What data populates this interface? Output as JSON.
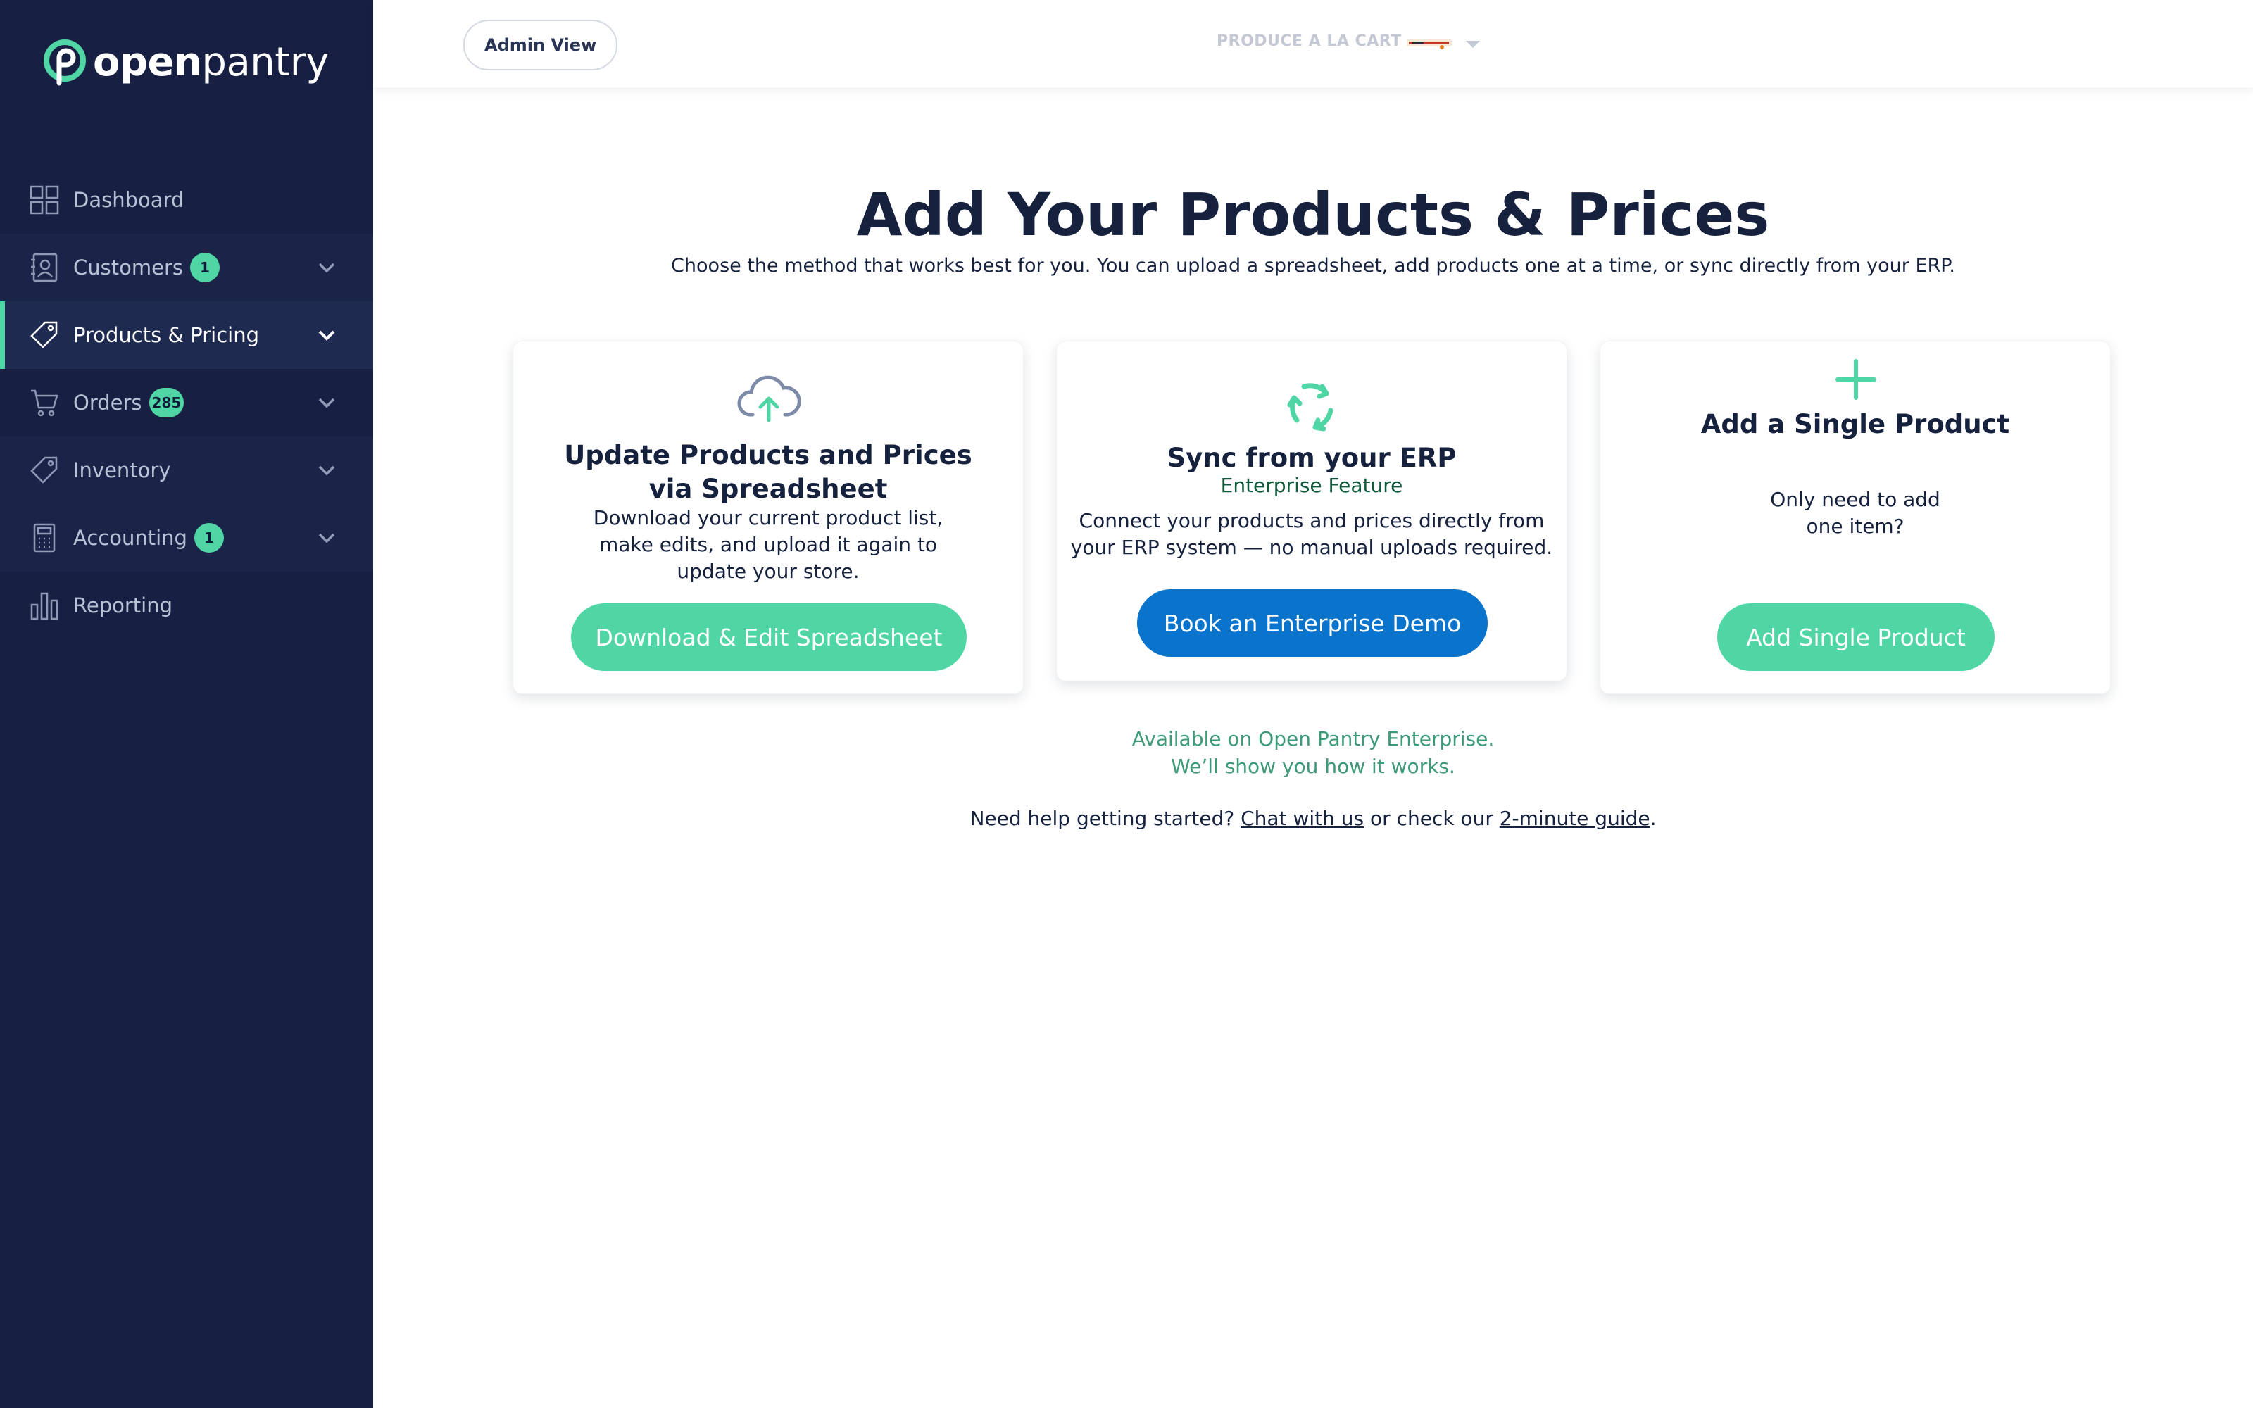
{
  "brand": {
    "name_bold": "open",
    "name_rest": "pantry",
    "accent": "#4fd6a4",
    "sidebar_bg": "#172042"
  },
  "sidebar": {
    "items": [
      {
        "label": "Dashboard",
        "icon": "grid-icon",
        "badge": null,
        "chevron": false
      },
      {
        "label": "Customers",
        "icon": "contacts-icon",
        "badge": "1",
        "chevron": true
      },
      {
        "label": "Products & Pricing",
        "icon": "tag-icon",
        "badge": null,
        "chevron": true,
        "active": true
      },
      {
        "label": "Orders",
        "icon": "cart-icon",
        "badge": "285",
        "chevron": true
      },
      {
        "label": "Inventory",
        "icon": "tag-icon",
        "badge": null,
        "chevron": true
      },
      {
        "label": "Accounting",
        "icon": "calculator-icon",
        "badge": "1",
        "chevron": true
      },
      {
        "label": "Reporting",
        "icon": "bar-chart-icon",
        "badge": null,
        "chevron": false
      }
    ]
  },
  "topbar": {
    "admin_view_label": "Admin View",
    "store_name": "PRODUCE A LA CART"
  },
  "main": {
    "title": "Add Your Products & Prices",
    "subtitle": "Choose the method that works best for you. You can upload a spreadsheet, add products one at a time, or sync directly from your ERP.",
    "cards": {
      "spreadsheet": {
        "icon": "cloud-upload-icon",
        "title_line1": "Update Products and Prices",
        "title_line2": "via Spreadsheet",
        "text_line1": "Download your current product list,",
        "text_line2": "make edits, and upload it again to",
        "text_line3": "update your store.",
        "button": "Download & Edit Spreadsheet"
      },
      "erp": {
        "icon": "sync-icon",
        "title": "Sync from your ERP",
        "subtitle": "Enterprise Feature",
        "text_line1": "Connect your products and prices directly from",
        "text_line2": "your ERP system — no manual uploads required.",
        "button": "Book an Enterprise Demo"
      },
      "single": {
        "icon": "plus-icon",
        "title": "Add a Single Product",
        "text_line1": "Only need to add",
        "text_line2": "one item?",
        "button": "Add Single Product"
      }
    },
    "available_line1": "Available on Open Pantry Enterprise.",
    "available_line2": "We’ll show you how it works.",
    "help": {
      "prefix": "Need help getting started?",
      "chat_link": "Chat with us",
      "middle": "or check our",
      "guide_link": "2-minute guide",
      "suffix": "."
    }
  }
}
